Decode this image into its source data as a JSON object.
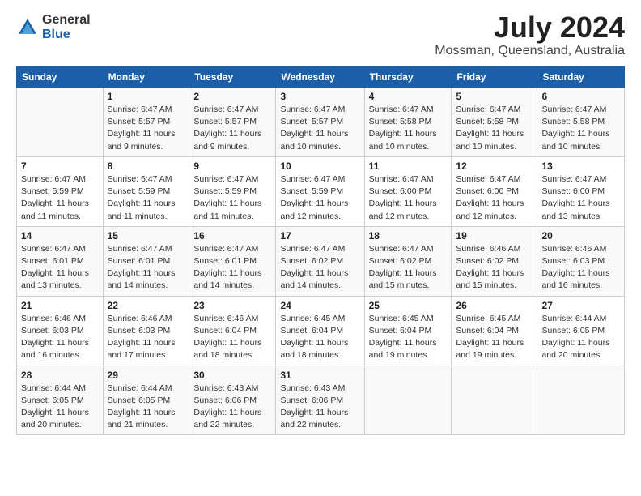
{
  "header": {
    "logo_general": "General",
    "logo_blue": "Blue",
    "title": "July 2024",
    "location": "Mossman, Queensland, Australia"
  },
  "days_of_week": [
    "Sunday",
    "Monday",
    "Tuesday",
    "Wednesday",
    "Thursday",
    "Friday",
    "Saturday"
  ],
  "weeks": [
    [
      {
        "day": "",
        "info": ""
      },
      {
        "day": "1",
        "info": "Sunrise: 6:47 AM\nSunset: 5:57 PM\nDaylight: 11 hours and 9 minutes."
      },
      {
        "day": "2",
        "info": "Sunrise: 6:47 AM\nSunset: 5:57 PM\nDaylight: 11 hours and 9 minutes."
      },
      {
        "day": "3",
        "info": "Sunrise: 6:47 AM\nSunset: 5:57 PM\nDaylight: 11 hours and 10 minutes."
      },
      {
        "day": "4",
        "info": "Sunrise: 6:47 AM\nSunset: 5:58 PM\nDaylight: 11 hours and 10 minutes."
      },
      {
        "day": "5",
        "info": "Sunrise: 6:47 AM\nSunset: 5:58 PM\nDaylight: 11 hours and 10 minutes."
      },
      {
        "day": "6",
        "info": "Sunrise: 6:47 AM\nSunset: 5:58 PM\nDaylight: 11 hours and 10 minutes."
      }
    ],
    [
      {
        "day": "7",
        "info": "Sunrise: 6:47 AM\nSunset: 5:59 PM\nDaylight: 11 hours and 11 minutes."
      },
      {
        "day": "8",
        "info": "Sunrise: 6:47 AM\nSunset: 5:59 PM\nDaylight: 11 hours and 11 minutes."
      },
      {
        "day": "9",
        "info": "Sunrise: 6:47 AM\nSunset: 5:59 PM\nDaylight: 11 hours and 11 minutes."
      },
      {
        "day": "10",
        "info": "Sunrise: 6:47 AM\nSunset: 5:59 PM\nDaylight: 11 hours and 12 minutes."
      },
      {
        "day": "11",
        "info": "Sunrise: 6:47 AM\nSunset: 6:00 PM\nDaylight: 11 hours and 12 minutes."
      },
      {
        "day": "12",
        "info": "Sunrise: 6:47 AM\nSunset: 6:00 PM\nDaylight: 11 hours and 12 minutes."
      },
      {
        "day": "13",
        "info": "Sunrise: 6:47 AM\nSunset: 6:00 PM\nDaylight: 11 hours and 13 minutes."
      }
    ],
    [
      {
        "day": "14",
        "info": "Sunrise: 6:47 AM\nSunset: 6:01 PM\nDaylight: 11 hours and 13 minutes."
      },
      {
        "day": "15",
        "info": "Sunrise: 6:47 AM\nSunset: 6:01 PM\nDaylight: 11 hours and 14 minutes."
      },
      {
        "day": "16",
        "info": "Sunrise: 6:47 AM\nSunset: 6:01 PM\nDaylight: 11 hours and 14 minutes."
      },
      {
        "day": "17",
        "info": "Sunrise: 6:47 AM\nSunset: 6:02 PM\nDaylight: 11 hours and 14 minutes."
      },
      {
        "day": "18",
        "info": "Sunrise: 6:47 AM\nSunset: 6:02 PM\nDaylight: 11 hours and 15 minutes."
      },
      {
        "day": "19",
        "info": "Sunrise: 6:46 AM\nSunset: 6:02 PM\nDaylight: 11 hours and 15 minutes."
      },
      {
        "day": "20",
        "info": "Sunrise: 6:46 AM\nSunset: 6:03 PM\nDaylight: 11 hours and 16 minutes."
      }
    ],
    [
      {
        "day": "21",
        "info": "Sunrise: 6:46 AM\nSunset: 6:03 PM\nDaylight: 11 hours and 16 minutes."
      },
      {
        "day": "22",
        "info": "Sunrise: 6:46 AM\nSunset: 6:03 PM\nDaylight: 11 hours and 17 minutes."
      },
      {
        "day": "23",
        "info": "Sunrise: 6:46 AM\nSunset: 6:04 PM\nDaylight: 11 hours and 18 minutes."
      },
      {
        "day": "24",
        "info": "Sunrise: 6:45 AM\nSunset: 6:04 PM\nDaylight: 11 hours and 18 minutes."
      },
      {
        "day": "25",
        "info": "Sunrise: 6:45 AM\nSunset: 6:04 PM\nDaylight: 11 hours and 19 minutes."
      },
      {
        "day": "26",
        "info": "Sunrise: 6:45 AM\nSunset: 6:04 PM\nDaylight: 11 hours and 19 minutes."
      },
      {
        "day": "27",
        "info": "Sunrise: 6:44 AM\nSunset: 6:05 PM\nDaylight: 11 hours and 20 minutes."
      }
    ],
    [
      {
        "day": "28",
        "info": "Sunrise: 6:44 AM\nSunset: 6:05 PM\nDaylight: 11 hours and 20 minutes."
      },
      {
        "day": "29",
        "info": "Sunrise: 6:44 AM\nSunset: 6:05 PM\nDaylight: 11 hours and 21 minutes."
      },
      {
        "day": "30",
        "info": "Sunrise: 6:43 AM\nSunset: 6:06 PM\nDaylight: 11 hours and 22 minutes."
      },
      {
        "day": "31",
        "info": "Sunrise: 6:43 AM\nSunset: 6:06 PM\nDaylight: 11 hours and 22 minutes."
      },
      {
        "day": "",
        "info": ""
      },
      {
        "day": "",
        "info": ""
      },
      {
        "day": "",
        "info": ""
      }
    ]
  ]
}
